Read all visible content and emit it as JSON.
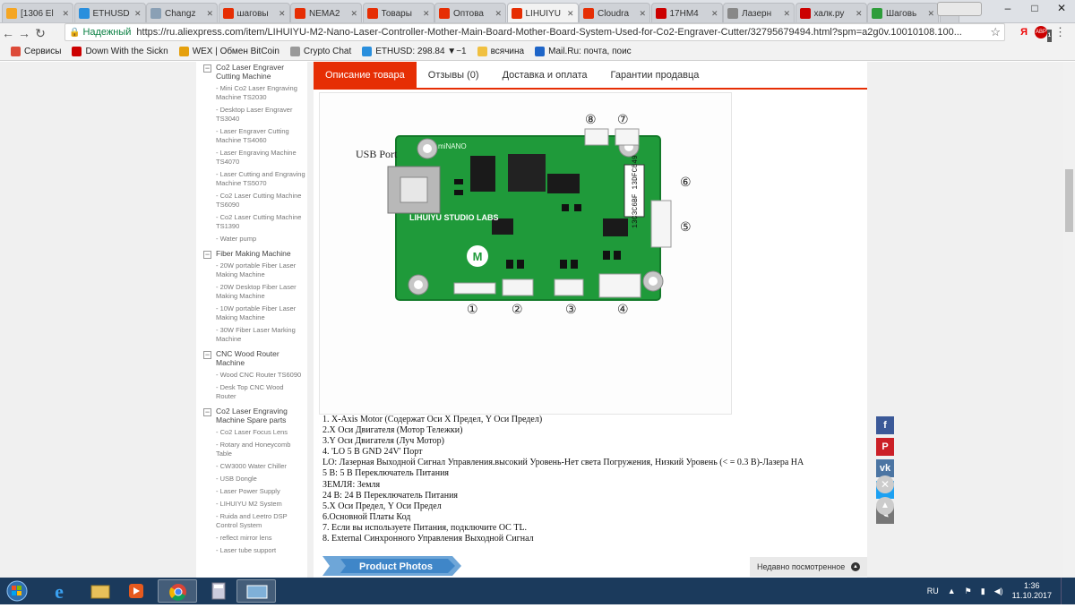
{
  "browser": {
    "tabs": [
      {
        "label": "[1306 El",
        "color": "#f5a623"
      },
      {
        "label": "ETHUSD",
        "color": "#2a8fdd"
      },
      {
        "label": "Changz",
        "color": "#8aa0b5"
      },
      {
        "label": "шаговы",
        "color": "#e62e04"
      },
      {
        "label": "NEMA2",
        "color": "#e62e04"
      },
      {
        "label": "Товары",
        "color": "#e62e04"
      },
      {
        "label": "Оптова",
        "color": "#e62e04"
      },
      {
        "label": "LIHUIYU",
        "color": "#e62e04"
      },
      {
        "label": "Cloudra",
        "color": "#e62e04"
      },
      {
        "label": "17HM4",
        "color": "#cc0000"
      },
      {
        "label": "Лазерн",
        "color": "#888888"
      },
      {
        "label": "халк.ру",
        "color": "#cc0000"
      },
      {
        "label": "Шаговь",
        "color": "#2e9d3a"
      }
    ],
    "active_tab_index": 7,
    "secure_label": "Надежный",
    "url": "https://ru.aliexpress.com/item/LIHUIYU-M2-Nano-Laser-Controller-Mother-Main-Board-Mother-Board-System-Used-for-Co2-Engraver-Cutter/32795679494.html?spm=a2g0v.10010108.100...",
    "bookmarks": [
      {
        "label": "Сервисы",
        "color": "#dd4b39"
      },
      {
        "label": "Down With the Sickn",
        "color": "#cc0000"
      },
      {
        "label": "WEX | Обмен BitCoin",
        "color": "#e5a00d"
      },
      {
        "label": "Crypto Chat",
        "color": "#999999"
      },
      {
        "label": "ETHUSD: 298.84 ▼−1",
        "color": "#2a8fdd"
      },
      {
        "label": "всячина",
        "color": "#f0c040"
      },
      {
        "label": "Mail.Ru: почта, поис",
        "color": "#1e65c8"
      }
    ],
    "ext_badge": "1"
  },
  "sidebar": {
    "groups": [
      {
        "title": "Co2 Laser Engraver Cutting Machine",
        "items": [
          "- Mini Co2 Laser Engraving Machine TS2030",
          "- Desktop Laser Engraver TS3040",
          "- Laser Engraver Cutting Machine TS4060",
          "- Laser Engraving Machine TS4070",
          "- Laser Cutting and Engraving Machine TS5070",
          "- Co2 Laser Cutting Machine TS6090",
          "- Co2 Laser Cutting Machine TS1390",
          "- Water pump"
        ]
      },
      {
        "title": "Fiber Making Machine",
        "items": [
          "- 20W portable Fiber Laser Making Machine",
          "- 20W Desktop Fiber Laser Making Machine",
          "- 10W portable Fiber Laser Making Machine",
          "- 30W Fiber Laser Marking Machine"
        ]
      },
      {
        "title": "CNC Wood Router Machine",
        "items": [
          "- Wood CNC Router TS6090",
          "- Desk Top CNC Wood Router"
        ]
      },
      {
        "title": "Co2 Laser Engraving Machine Spare parts",
        "items": [
          "- Co2 Laser Focus Lens",
          "- Rotary and Honeycomb Table",
          "- CW3000 Water Chiller",
          "- USB Dongle",
          "- Laser Power Supply",
          "- LIHUIYU M2 System",
          "- Ruida and Leetro DSP Control System",
          "- reflect mirror lens",
          "- Laser tube support"
        ]
      }
    ]
  },
  "product_tabs": [
    "Описание товара",
    "Отзывы (0)",
    "Доставка и оплата",
    "Гарантии продавца"
  ],
  "board_image": {
    "usb_label": "USB Port",
    "silk_top": "miNANO",
    "silk_brand": "LIHUIYU STUDIO LABS",
    "chip_label": "13C3C6BF 13DFC849",
    "markers": [
      "①",
      "②",
      "③",
      "④",
      "⑤",
      "⑥",
      "⑦",
      "⑧"
    ]
  },
  "description": [
    "1. X-Axis Motor (Содержат Оси X Предел, Y Оси Предел)",
    "2.X Оси Двигателя (Мотор Тележки)",
    "3.Y Оси Двигателя (Луч Мотор)",
    "4. 'LO 5 B GND 24V' Порт",
    "LO: Лазерная Выходной Сигнал Управления.высокий Уровень-Нет света Погружения, Низкий Уровень (< = 0.3 В)-Лазера НА",
    "5 В: 5 В Переключатель Питания",
    "ЗЕМЛЯ: Земля",
    "24 В: 24 В Переключатель Питания",
    "5.X Оси Предел, Y Оси Предел",
    "6.Основной Платы Код",
    "7. Если вы используете Питания, подключите ОС TL.",
    "8. External Синхронного Управления Выходной Сигнал"
  ],
  "product_photos_label": "Product Photos",
  "social": [
    {
      "icon": "f",
      "name": "facebook-icon",
      "color": "#3b5998"
    },
    {
      "icon": "P",
      "name": "pinterest-icon",
      "color": "#cb2027"
    },
    {
      "icon": "vk",
      "name": "vk-icon",
      "color": "#4c75a3"
    },
    {
      "icon": "t",
      "name": "twitter-icon",
      "color": "#1da1f2"
    },
    {
      "icon": "✎",
      "name": "edit-icon",
      "color": "#777777"
    }
  ],
  "recently_viewed": "Недавно посмотренное",
  "taskbar": {
    "lang": "RU",
    "time": "1:36",
    "date": "11.10.2017"
  }
}
